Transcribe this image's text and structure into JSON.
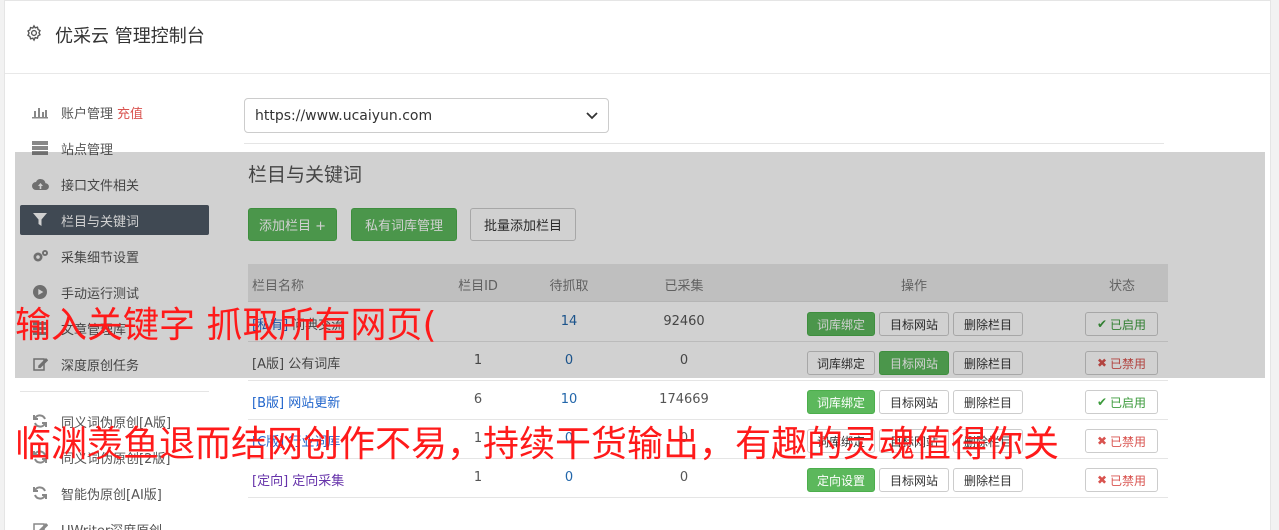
{
  "header": {
    "title": "优采云 管理控制台",
    "icon": "gear-icon"
  },
  "sidebar": {
    "items": [
      {
        "label": "账户管理",
        "extra": "充值",
        "icon": "bar-chart-icon"
      },
      {
        "label": "站点管理",
        "icon": "server-icon"
      },
      {
        "label": "接口文件相关",
        "icon": "cloud-upload-icon"
      },
      {
        "label": "栏目与关键词",
        "icon": "filter-icon"
      },
      {
        "label": "采集细节设置",
        "icon": "cogs-icon"
      },
      {
        "label": "手动运行测试",
        "icon": "play-icon"
      },
      {
        "label": "文章管理库",
        "icon": "list-icon"
      },
      {
        "label": "深度原创任务",
        "icon": "edit-icon"
      },
      {
        "label": "同义词伪原创[A版]",
        "icon": "refresh-icon"
      },
      {
        "label": "同义词伪原创[2版]",
        "icon": "refresh-icon"
      },
      {
        "label": "智能伪原创[AI版]",
        "icon": "refresh-icon"
      },
      {
        "label": "UWriter深度原创",
        "icon": "edit-icon"
      }
    ]
  },
  "main": {
    "site_select": "https://www.ucaiyun.com",
    "section_title": "栏目与关键词",
    "buttons": {
      "add_column": "添加栏目 +",
      "private_lexicon": "私有词库管理",
      "batch_add": "批量添加栏目"
    },
    "table": {
      "headers": [
        "栏目名称",
        "栏目ID",
        "待抓取",
        "已采集",
        "操作",
        "状态"
      ],
      "rows": [
        {
          "tag": "[私有]",
          "name": "问典交流",
          "id": "",
          "pending": "14",
          "collected": "92460",
          "ops": [
            "词库绑定",
            "目标网站",
            "删除栏目"
          ],
          "status": "已启用",
          "enabled": true
        },
        {
          "tag": "[A版]",
          "name": "公有词库",
          "id": "1",
          "pending": "0",
          "collected": "0",
          "ops": [
            "词库绑定",
            "目标网站",
            "删除栏目"
          ],
          "status": "已禁用",
          "enabled": false
        },
        {
          "tag": "[B版]",
          "name": "网站更新",
          "id": "6",
          "pending": "10",
          "collected": "174669",
          "ops": [
            "词库绑定",
            "目标网站",
            "删除栏目"
          ],
          "status": "已启用",
          "enabled": true
        },
        {
          "tag": "[C版]",
          "name": "行业词库",
          "id": "1",
          "pending": "0",
          "collected": "0",
          "ops": [
            "词库绑定",
            "目标网站",
            "删除栏目"
          ],
          "status": "已禁用",
          "enabled": false
        },
        {
          "tag": "[定向]",
          "name": "定向采集",
          "id": "1",
          "pending": "0",
          "collected": "0",
          "ops": [
            "定向设置",
            "目标网站",
            "删除栏目"
          ],
          "status": "已禁用",
          "enabled": false
        }
      ]
    }
  },
  "overlay_captions": {
    "line1": "输入关键字 抓取所有网页(",
    "line2": "临渊羡鱼退而结网创作不易，持续干货输出，有趣的灵魂值得你关"
  },
  "colors": {
    "accent_green": "#5cb85c",
    "active_nav": "#4f5a66",
    "danger": "#d9534f",
    "caption": "#ff1a1a"
  }
}
